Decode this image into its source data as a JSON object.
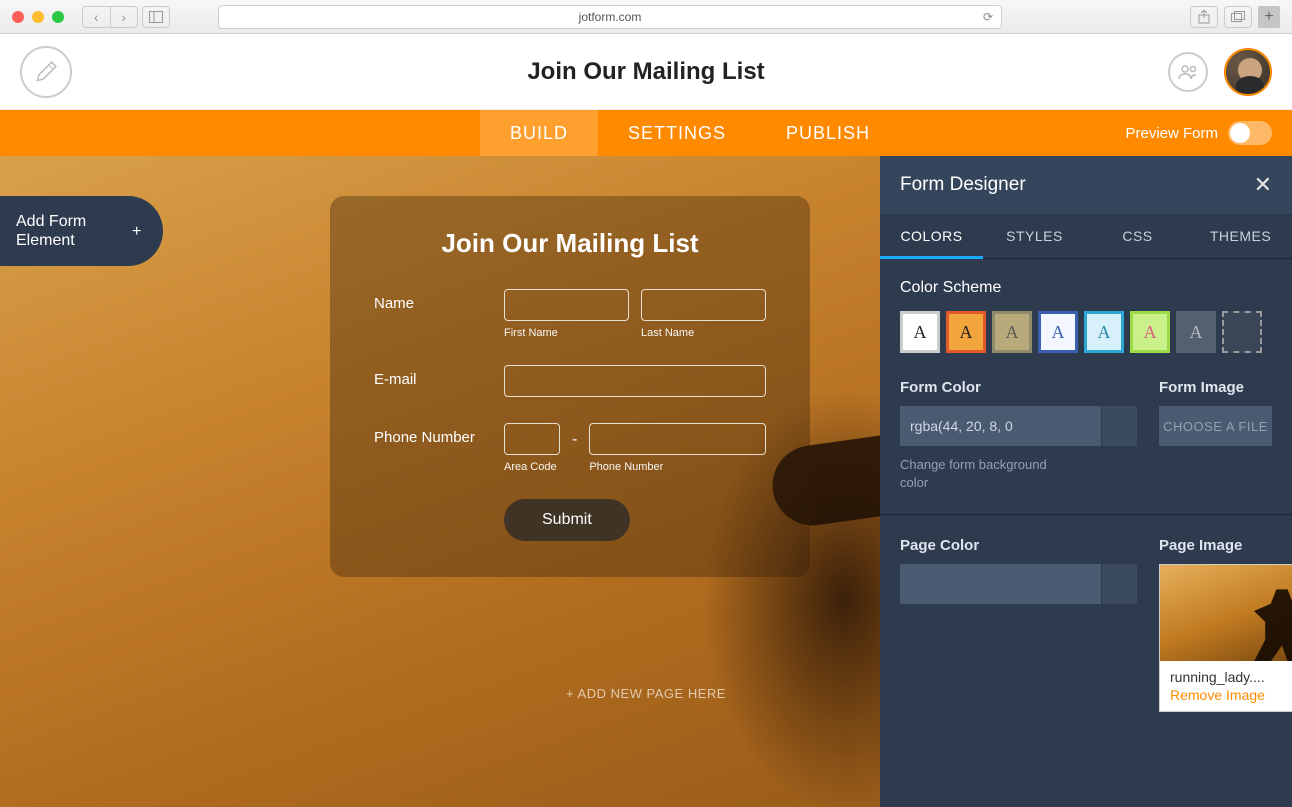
{
  "browser": {
    "url": "jotform.com"
  },
  "header": {
    "title": "Join Our Mailing List"
  },
  "nav": {
    "tabs": [
      "BUILD",
      "SETTINGS",
      "PUBLISH"
    ],
    "preview_label": "Preview Form"
  },
  "add_element": {
    "label": "Add Form Element"
  },
  "form": {
    "heading": "Join Our Mailing List",
    "rows": {
      "name": {
        "label": "Name",
        "sub1": "First Name",
        "sub2": "Last Name"
      },
      "email": {
        "label": "E-mail"
      },
      "phone": {
        "label": "Phone Number",
        "sub1": "Area Code",
        "sub2": "Phone Number"
      }
    },
    "submit": "Submit",
    "add_page": "+ ADD NEW PAGE HERE"
  },
  "designer": {
    "title": "Form Designer",
    "tabs": [
      "COLORS",
      "STYLES",
      "CSS",
      "THEMES"
    ],
    "color_scheme_label": "Color Scheme",
    "swatches": [
      {
        "letter": "A",
        "bg": "#ffffff",
        "fg": "#222222",
        "border": "#cccccc"
      },
      {
        "letter": "A",
        "bg": "#f2a53a",
        "fg": "#222222",
        "border": "#e05a2b"
      },
      {
        "letter": "A",
        "bg": "#b8a97a",
        "fg": "#5a5a5a",
        "border": "#8f8a6a"
      },
      {
        "letter": "A",
        "bg": "#f3f6ff",
        "fg": "#3a5fae",
        "border": "#3a5fae"
      },
      {
        "letter": "A",
        "bg": "#d7f0fa",
        "fg": "#2a8aae",
        "border": "#2aa7d4"
      },
      {
        "letter": "A",
        "bg": "#c9f08a",
        "fg": "#e05a84",
        "border": "#9edc47"
      },
      {
        "letter": "A",
        "bg": "#55606f",
        "fg": "#b6bbc4",
        "border": "#55606f"
      }
    ],
    "form_color": {
      "label": "Form Color",
      "value": "rgba(44, 20, 8, 0",
      "hint": "Change form background color"
    },
    "form_image": {
      "label": "Form Image",
      "button": "CHOOSE A FILE"
    },
    "page_color": {
      "label": "Page Color",
      "value": ""
    },
    "page_image": {
      "label": "Page Image",
      "filename": "running_lady....",
      "remove": "Remove Image"
    }
  }
}
